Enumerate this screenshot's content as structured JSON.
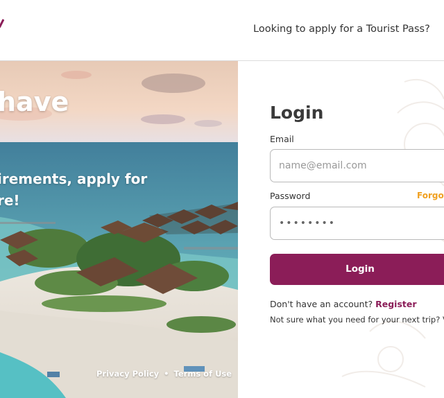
{
  "header": {
    "tourist_pass_link": "Looking to apply for a Tourist Pass?"
  },
  "hero": {
    "title": "have",
    "subtitle_line1": "irements, apply for",
    "subtitle_line2": "re!",
    "privacy_policy": "Privacy Policy",
    "separator": "•",
    "terms_of_use": "Terms of Use"
  },
  "login": {
    "title": "Login",
    "email_label": "Email",
    "email_placeholder": "name@email.com",
    "password_label": "Password",
    "forgot_label": "Forgot",
    "password_value": "••••••••",
    "button_label": "Login",
    "no_account_text": "Don't have an account?",
    "register_label": "Register",
    "next_trip_text": "Not sure what you need for your next trip? V"
  },
  "colors": {
    "accent": "#8b1d58",
    "forgot": "#f0a020"
  }
}
